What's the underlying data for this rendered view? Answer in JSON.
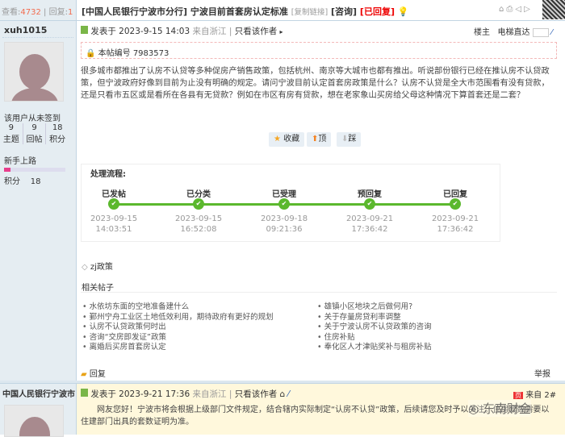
{
  "header": {
    "views_label": "查看:",
    "views": "4732",
    "replies_label": "回复:",
    "replies": "1",
    "title_prefix": "[中国人民银行宁波市分行]",
    "title": "宁波目前首套房认定标准",
    "copy_link": "[复制链接]",
    "category": "[咨询]",
    "status": "[已回复]"
  },
  "post1": {
    "author": "xuh1015",
    "signin": "该用户从未签到",
    "stats": [
      {
        "v": "9",
        "l": "主题"
      },
      {
        "v": "9",
        "l": "回帖"
      },
      {
        "v": "18",
        "l": "积分"
      }
    ],
    "rank": "新手上路",
    "rank_progress": 0.1,
    "points_label": "积分",
    "points": "18",
    "posted": "发表于 2023-9-15 14:03",
    "from": "来自浙江",
    "only_author": "只看该作者",
    "floor": "楼主",
    "elevator": "电梯直达",
    "post_no": "本帖编号 7983573",
    "body": "很多城市都推出了认房不认贷等多种促房产销售政策，包括杭州、南京等大城市也都有推出。听说部份银行已经在推认房不认贷政策，但宁波政府好像到目前为止没有明确的规定。请问宁波目前认定首套房政策是什么？认房不认贷是全大市范围看有没有贷款，还是只看市五区或是看所在各县有无贷款？例如在市区有房有贷款，想在老家象山买房给父母这种情况下算首套还是二套？",
    "buttons": {
      "fav": "收藏",
      "up": "顶",
      "down": "踩"
    },
    "process": {
      "title": "处理流程:",
      "steps": [
        {
          "label": "已发帖",
          "date": "2023-09-15",
          "time": "14:03:51"
        },
        {
          "label": "已分类",
          "date": "2023-09-15",
          "time": "16:52:08"
        },
        {
          "label": "已受理",
          "date": "2023-09-18",
          "time": "09:21:36"
        },
        {
          "label": "预回复",
          "date": "2023-09-21",
          "time": "17:36:42"
        },
        {
          "label": "已回复",
          "date": "2023-09-21",
          "time": "17:36:42"
        }
      ]
    },
    "tag": "zj政策",
    "related_title": "相关帖子",
    "related": [
      "水依坊东面的空地准备建什么",
      "鄞州宁舟工业区土地低效利用，期待政府有更好的规划",
      "认房不认贷政策何时出",
      "咨询“交房即发证”政策",
      "离婚后买房首套房认定",
      "雄镇小区地块之后做何用?",
      "关于存量房贷利率调整",
      "关于宁波认房不认贷政策的咨询",
      "住房补贴",
      "奉化区人才津贴奖补与租房补贴"
    ],
    "reply": "回复",
    "report": "举报"
  },
  "post2": {
    "author": "中国人民银行宁波市",
    "posted": "发表于 2023-9-21 17:36",
    "from": "来自浙江",
    "only_author": "只看该作者",
    "floor": "来自 2#",
    "body": "网友您好！宁波市将会根据上级部门文件规定，结合辖内实际制定“认房不认贷”政策，后续请您及时予以关注。住房套数需要以住建部门出具的套数证明为准。",
    "watermark": "东南财金"
  }
}
